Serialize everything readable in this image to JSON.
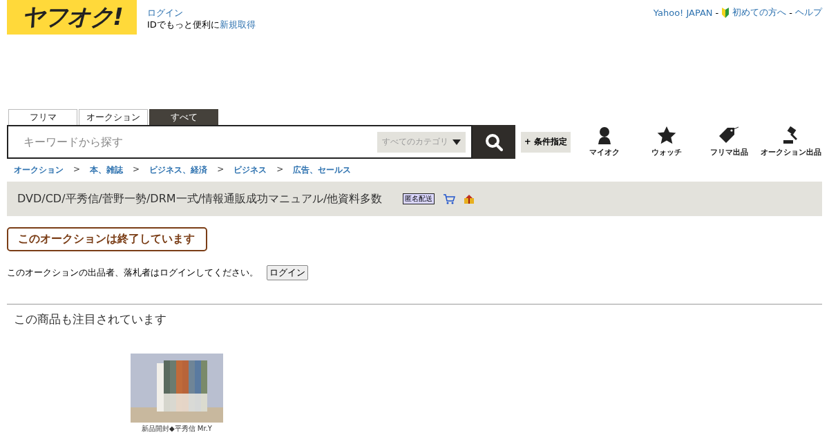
{
  "header": {
    "logo": "ヤフオク!",
    "login_link": "ログイン",
    "id_text": "IDでもっと便利に",
    "signup_link": "新規取得",
    "links": [
      {
        "label": "Yahoo! JAPAN",
        "kind": "plain"
      },
      {
        "label": "初めての方へ",
        "kind": "beginner"
      },
      {
        "label": "ヘルプ",
        "kind": "plain"
      }
    ],
    "separator": "-"
  },
  "search": {
    "tabs": [
      {
        "label": "フリマ",
        "selected": false
      },
      {
        "label": "オークション",
        "selected": false
      },
      {
        "label": "すべて",
        "selected": true
      }
    ],
    "placeholder": "キーワードから探す",
    "category": "すべてのカテゴリ",
    "advanced": "+ 条件指定"
  },
  "nav": [
    {
      "label": "マイオク",
      "kind": "person"
    },
    {
      "label": "ウォッチ",
      "kind": "star"
    },
    {
      "label": "フリマ出品",
      "kind": "tag"
    },
    {
      "label": "オークション出品",
      "kind": "gavel"
    }
  ],
  "breadcrumb": {
    "items": [
      "オークション",
      "本、雑誌",
      "ビジネス、経済",
      "ビジネス",
      "広告、セールス"
    ],
    "separator": ">"
  },
  "item": {
    "title": "DVD/CD/平秀信/菅野一勢/DRM一式/情報通販成功マニュアル/他資料多数",
    "badge": "匿名配送"
  },
  "ended": "このオークションは終了しています",
  "login_notice": {
    "text": "このオークションの出品者、落札者はログインしてください。",
    "button": "ログイン"
  },
  "related": {
    "heading": "この商品も注目されています",
    "items": [
      {
        "caption": "新品開封◆平秀信 Mr.Y"
      }
    ]
  }
}
